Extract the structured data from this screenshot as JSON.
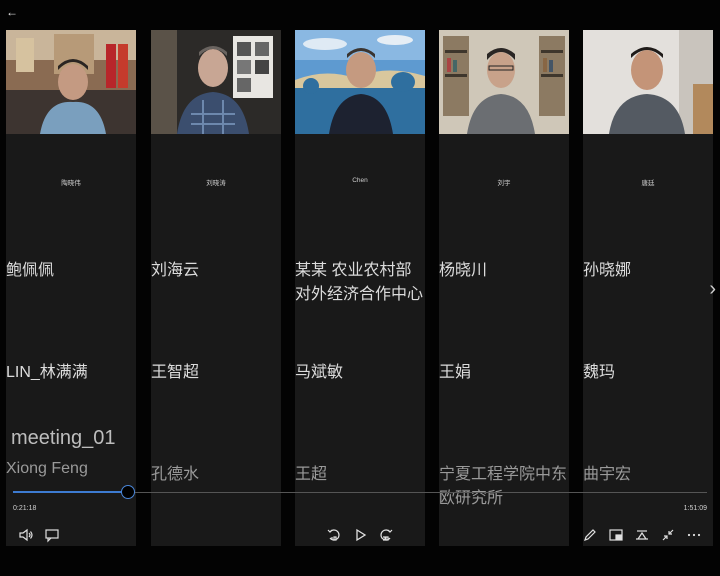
{
  "header": {
    "back_icon": "arrow-left"
  },
  "participants": [
    {
      "name": "陶晓伟"
    },
    {
      "name": "刘晓涛"
    },
    {
      "name": "Chen"
    },
    {
      "name": "刘宇"
    },
    {
      "name": "唐廷"
    }
  ],
  "grid_rows": [
    [
      "鲍佩佩",
      "刘海云",
      "某某 农业农村部对外经济合作中心",
      "杨晓川",
      "孙晓娜"
    ],
    [
      "LIN_林满满",
      "王智超",
      "马斌敏",
      "王娟",
      "魏玛"
    ],
    [
      "Xiong Feng",
      "孔德水",
      "王超",
      "宁夏工程学院中东欧研究所",
      "曲宇宏"
    ]
  ],
  "player": {
    "title": "meeting_01",
    "elapsed": "0:21:18",
    "total": "1:51:09",
    "progress_fraction": 0.166
  },
  "controls": {
    "left": [
      "volume-icon",
      "captions-icon"
    ],
    "center": [
      "skip-back-10-icon",
      "play-icon",
      "skip-forward-30-icon"
    ],
    "right": [
      "edit-icon",
      "mini-view-icon",
      "cast-icon",
      "minimize-icon",
      "more-icon"
    ]
  },
  "colors": {
    "accent": "#3d7bd1",
    "tile_bg": "#191919",
    "page_bg": "#030303"
  }
}
